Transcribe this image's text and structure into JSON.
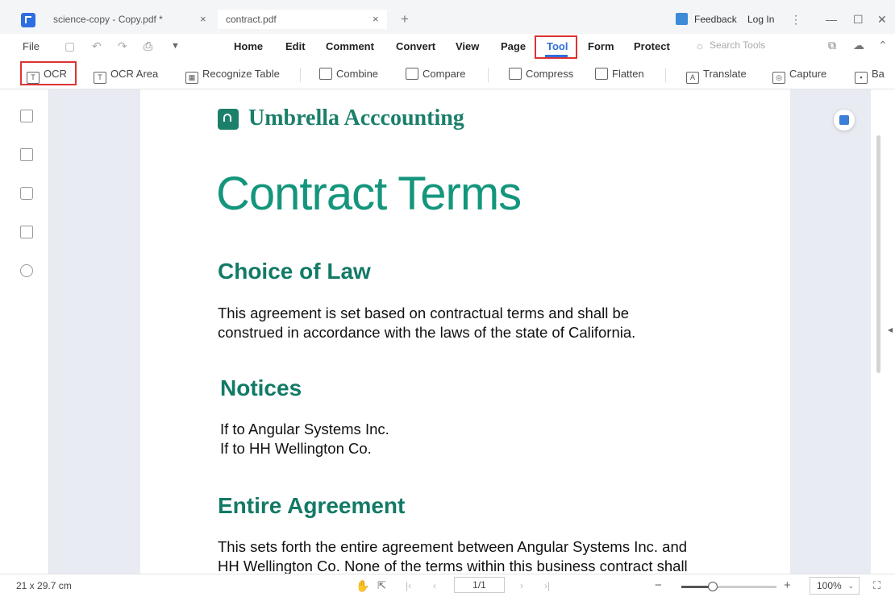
{
  "tabs": [
    {
      "title": "science-copy - Copy.pdf *",
      "close": "×"
    },
    {
      "title": "contract.pdf",
      "close": "×"
    }
  ],
  "new_tab": "+",
  "window": {
    "feedback": "Feedback",
    "login": "Log In",
    "more": "⋮",
    "minimize": "—",
    "maximize": "☐",
    "close": "✕"
  },
  "menu": {
    "file": "File",
    "items": [
      "Home",
      "Edit",
      "Comment",
      "Convert",
      "View",
      "Page",
      "Tool",
      "Form",
      "Protect"
    ],
    "active": "Tool",
    "search_placeholder": "Search Tools"
  },
  "toolbar": {
    "items": [
      "OCR",
      "OCR Area",
      "Recognize Table",
      "Combine",
      "Compare",
      "Compress",
      "Flatten",
      "Translate",
      "Capture",
      "Ba"
    ]
  },
  "document": {
    "brand": "Umbrella Acccounting",
    "title": "Contract Terms",
    "sections": [
      {
        "heading": "Choice of Law",
        "lines": [
          "This agreement is set based on contractual terms and shall be",
          "construed in accordance with the laws of the state of California."
        ]
      },
      {
        "heading": "Notices",
        "lines": [
          "If to Angular Systems Inc.",
          "If to HH Wellington Co."
        ]
      },
      {
        "heading": "Entire Agreement",
        "lines": [
          "This sets forth the entire agreement between Angular Systems Inc. and",
          "HH Wellington Co. None of the terms within this business contract shall"
        ]
      }
    ]
  },
  "status": {
    "page_size": "21 x 29.7 cm",
    "page_indicator": "1/1",
    "zoom": "100%",
    "zoom_level": 0.33
  },
  "colors": {
    "accent": "#2f6ee0",
    "brand_green": "#1b7f6a",
    "title_green": "#14967c",
    "highlight": "#d33333"
  }
}
